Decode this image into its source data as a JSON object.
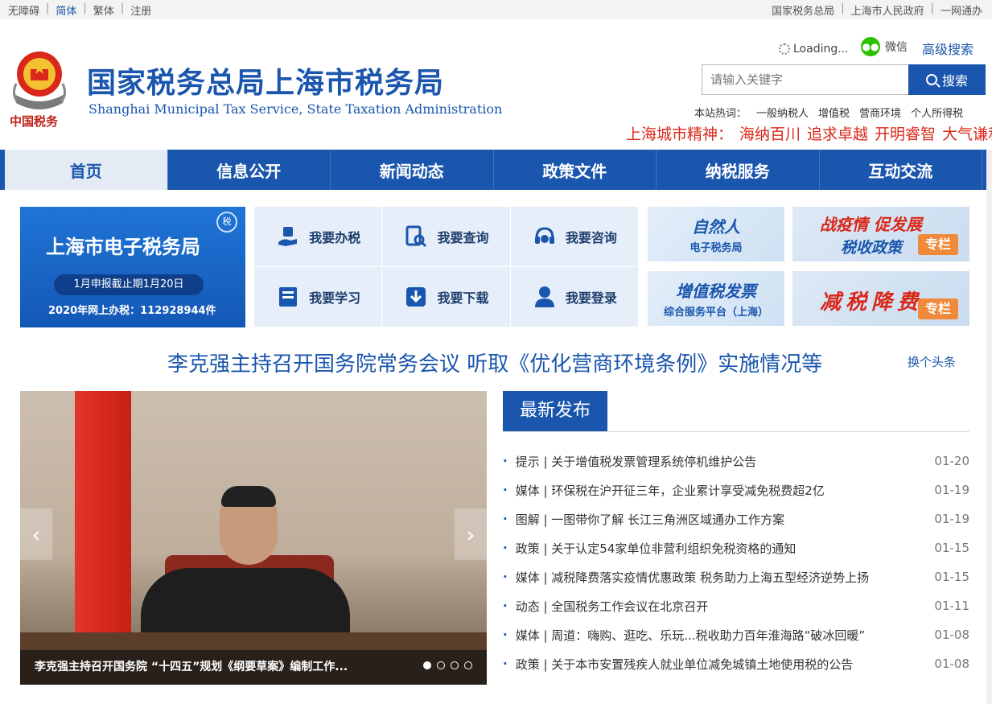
{
  "topbar": {
    "left": [
      "无障碍",
      "简体",
      "繁体",
      "注册"
    ],
    "right": [
      "国家税务总局",
      "上海市人民政府",
      "一网通办"
    ]
  },
  "header": {
    "title_cn": "国家税务总局上海市税务局",
    "title_en": "Shanghai Municipal Tax Service, State Taxation Administration",
    "emblem_text": "中国税务",
    "loading": "Loading...",
    "wechat": "微信",
    "advanced_search": "高级搜索",
    "search_placeholder": "请输入关键字",
    "search_button": "搜索",
    "hot_label": "本站热词：",
    "hot_words": [
      "一般纳税人",
      "增值税",
      "营商环境",
      "个人所得税"
    ],
    "spirit_label": "上海城市精神：",
    "spirit_words": [
      "海纳百川",
      "追求卓越",
      "开明睿智",
      "大气谦和"
    ]
  },
  "nav": [
    "首页",
    "信息公开",
    "新闻动态",
    "政策文件",
    "纳税服务",
    "互动交流"
  ],
  "etax": {
    "title": "上海市电子税务局",
    "deadline": "1月申报截止期1月20日",
    "stat": "2020年网上办税：112928944件",
    "badge": "税"
  },
  "quick": [
    {
      "label": "我要办税",
      "icon": "hand-tax-icon"
    },
    {
      "label": "我要查询",
      "icon": "document-search-icon"
    },
    {
      "label": "我要咨询",
      "icon": "headset-icon"
    },
    {
      "label": "我要学习",
      "icon": "book-icon"
    },
    {
      "label": "我要下载",
      "icon": "download-icon"
    },
    {
      "label": "我要登录",
      "icon": "user-icon"
    }
  ],
  "promos": {
    "natural_big": "自然人",
    "natural_small": "电子税务局",
    "vat_big": "增值税发票",
    "vat_small": "综合服务平台（上海）",
    "epidemic_l1": "战疫情 促发展",
    "epidemic_l2": "税收政策",
    "epidemic_tag": "专栏",
    "reduce_text": "减税降费",
    "reduce_tag": "专栏"
  },
  "headline": {
    "text": "李克强主持召开国务院常务会议 听取《优化营商环境条例》实施情况等",
    "change": "换个头条"
  },
  "carousel": {
    "caption": "李克强主持召开国务院 “十四五”规划《纲要草案》编制工作...",
    "prev": "‹",
    "next": "›"
  },
  "news": {
    "tab": "最新发布",
    "items": [
      {
        "text": "提示 | 关于增值税发票管理系统停机维护公告",
        "date": "01-20"
      },
      {
        "text": "媒体 | 环保税在沪开征三年，企业累计享受减免税费超2亿",
        "date": "01-19"
      },
      {
        "text": "图解 | 一图带你了解 长江三角洲区域通办工作方案",
        "date": "01-19"
      },
      {
        "text": "政策 | 关于认定54家单位非营利组织免税资格的通知",
        "date": "01-15"
      },
      {
        "text": "媒体 | 减税降费落实疫情优惠政策 税务助力上海五型经济逆势上扬",
        "date": "01-15"
      },
      {
        "text": "动态 | 全国税务工作会议在北京召开",
        "date": "01-11"
      },
      {
        "text": "媒体 | 周道：嗨购、逛吃、乐玩...税收助力百年淮海路“破冰回暖”",
        "date": "01-08"
      },
      {
        "text": "政策 | 关于本市安置残疾人就业单位减免城镇土地使用税的公告",
        "date": "01-08"
      }
    ]
  },
  "colors": {
    "brand": "#1a56ad",
    "accent_red": "#d9281a",
    "orange": "#f08a3a"
  }
}
